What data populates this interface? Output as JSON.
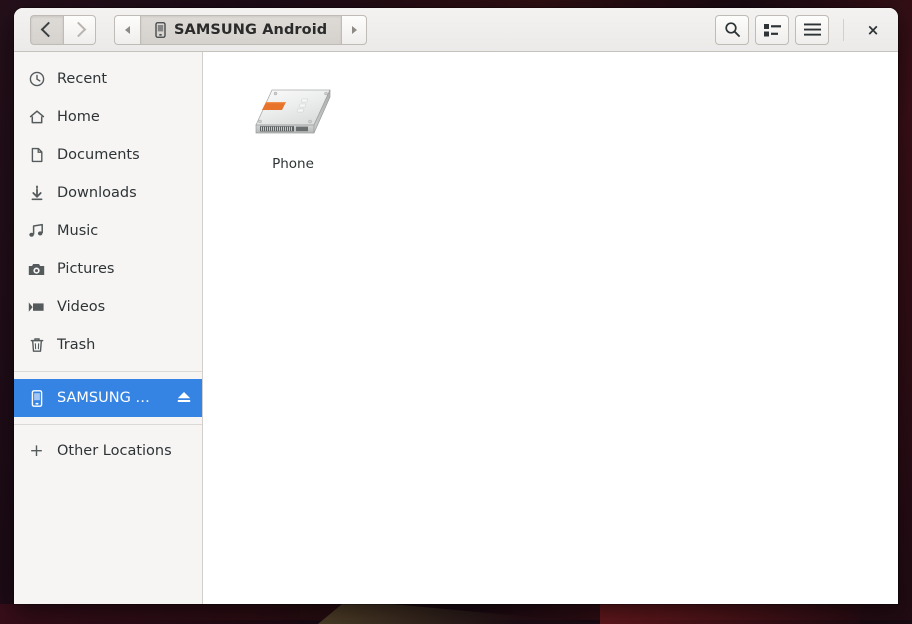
{
  "window": {
    "title": "SAMSUNG Android",
    "app": "files-manager"
  },
  "header": {
    "back_label": "Back",
    "forward_label": "Forward",
    "path_prev_label": "Previous path",
    "path_next_label": "Next path",
    "current_path": "SAMSUNG Android",
    "path_icon": "phone-icon",
    "buttons": {
      "search": "search-icon",
      "view_list": "list-view-icon",
      "menu": "hamburger-menu-icon",
      "close": "×"
    }
  },
  "sidebar": {
    "items": [
      {
        "label": "Recent",
        "icon": "clock-icon"
      },
      {
        "label": "Home",
        "icon": "home-icon"
      },
      {
        "label": "Documents",
        "icon": "document-icon"
      },
      {
        "label": "Downloads",
        "icon": "download-icon"
      },
      {
        "label": "Music",
        "icon": "music-note-icon"
      },
      {
        "label": "Pictures",
        "icon": "camera-icon"
      },
      {
        "label": "Videos",
        "icon": "video-camera-icon"
      },
      {
        "label": "Trash",
        "icon": "trash-icon"
      }
    ],
    "devices": [
      {
        "label": "SAMSUNG …",
        "icon": "phone-icon",
        "selected": true,
        "action_icon": "eject-icon"
      }
    ],
    "other_locations": {
      "label": "Other Locations",
      "icon": "plus-icon"
    }
  },
  "main": {
    "files": [
      {
        "name": "Phone",
        "icon": "drive-harddisk-icon"
      }
    ]
  },
  "colors": {
    "selection_blue": "#3584e4",
    "sidebar_bg": "#f6f5f4",
    "header_bg": "#f0eeec",
    "content_bg": "#ffffff",
    "text": "#2e3436",
    "drive_label_orange": "#e8732a"
  }
}
